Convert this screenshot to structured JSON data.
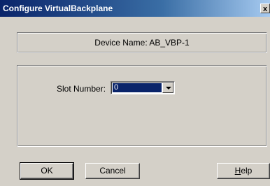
{
  "window": {
    "title": "Configure VirtualBackplane",
    "close_label": "x"
  },
  "device": {
    "label": "Device Name:",
    "value": "AB_VBP-1"
  },
  "slot": {
    "label": "Slot Number:",
    "selected_value": "0"
  },
  "buttons": {
    "ok_label": "OK",
    "cancel_label": "Cancel",
    "help_first": "H",
    "help_rest": "elp"
  },
  "colors": {
    "dialog_face": "#d4d0c8",
    "titlebar_start": "#0a246a",
    "titlebar_end": "#a6caf0",
    "selection": "#0a246a"
  }
}
